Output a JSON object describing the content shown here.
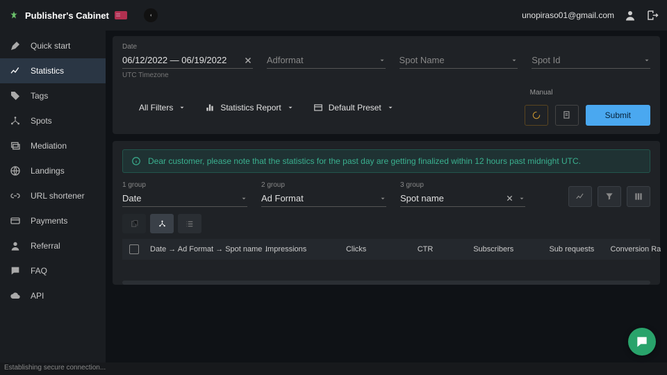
{
  "header": {
    "title": "Publisher's Cabinet",
    "user_email": "unopiraso01@gmail.com"
  },
  "sidebar": {
    "items": [
      {
        "label": "Quick start",
        "icon": "rocket"
      },
      {
        "label": "Statistics",
        "icon": "chart",
        "active": true
      },
      {
        "label": "Tags",
        "icon": "tag"
      },
      {
        "label": "Spots",
        "icon": "nodes"
      },
      {
        "label": "Mediation",
        "icon": "layers"
      },
      {
        "label": "Landings",
        "icon": "globe"
      },
      {
        "label": "URL shortener",
        "icon": "link"
      },
      {
        "label": "Payments",
        "icon": "card"
      },
      {
        "label": "Referral",
        "icon": "person"
      },
      {
        "label": "FAQ",
        "icon": "chat"
      },
      {
        "label": "API",
        "icon": "cloud"
      }
    ]
  },
  "filters": {
    "date_label": "Date",
    "date_value": "06/12/2022 — 06/19/2022",
    "date_hint": "UTC Timezone",
    "adformat_placeholder": "Adformat",
    "spotname_placeholder": "Spot Name",
    "spotid_placeholder": "Spot Id",
    "all_filters": "All Filters",
    "stats_report": "Statistics Report",
    "default_preset": "Default Preset",
    "manual": "Manual",
    "submit": "Submit"
  },
  "notice": {
    "text": "Dear customer, please note that the statistics for the past day are getting finalized within 12 hours past midnight UTC."
  },
  "groups": {
    "g1_label": "1 group",
    "g1_value": "Date",
    "g2_label": "2 group",
    "g2_value": "Ad Format",
    "g3_label": "3 group",
    "g3_value": "Spot name"
  },
  "table": {
    "col_path": "Date → Ad Format → Spot name ↓",
    "col_impressions": "Impressions",
    "col_clicks": "Clicks",
    "col_ctr": "CTR",
    "col_subscribers": "Subscribers",
    "col_subreq": "Sub requests",
    "col_conv": "Conversion Ra"
  },
  "status": {
    "text": "Establishing secure connection..."
  },
  "colors": {
    "accent_blue": "#4aa8f0",
    "accent_green": "#3ab08f",
    "fab_green": "#29a36b"
  }
}
